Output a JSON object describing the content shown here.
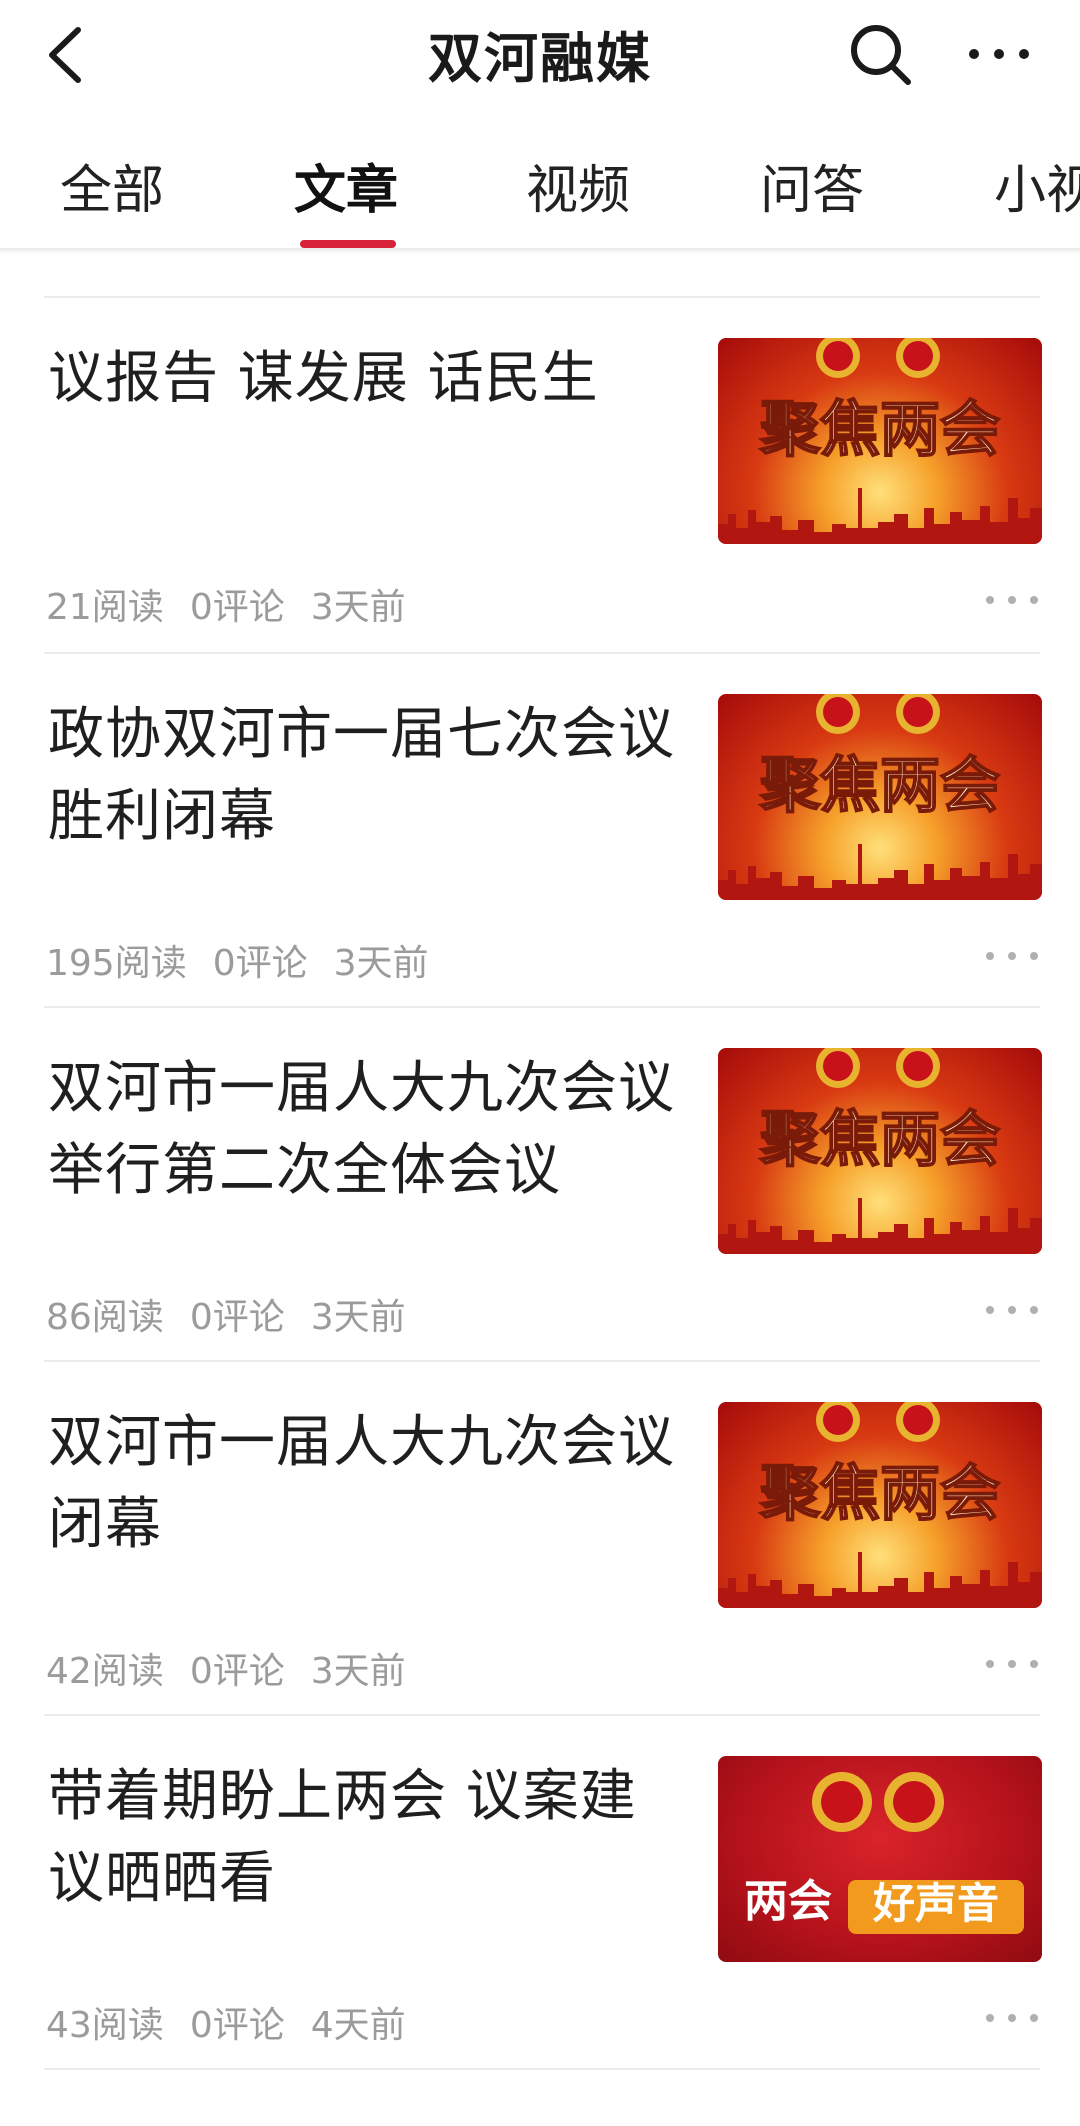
{
  "header": {
    "title": "双河融媒"
  },
  "tabs": [
    {
      "label": "全部"
    },
    {
      "label": "文章"
    },
    {
      "label": "视频"
    },
    {
      "label": "问答"
    },
    {
      "label": "小视"
    }
  ],
  "active_tab": "文章",
  "accent_color": "#d6223a",
  "articles": [
    {
      "title": "议报告 谋发展 话民生",
      "reads": "21阅读",
      "comments": "0评论",
      "time": "3天前",
      "thumb": {
        "text": "聚焦两会",
        "icon": "emblem-icon"
      }
    },
    {
      "title": "政协双河市一届七次会议胜利闭幕",
      "reads": "195阅读",
      "comments": "0评论",
      "time": "3天前",
      "thumb": {
        "text": "聚焦两会",
        "icon": "emblem-icon"
      }
    },
    {
      "title": "双河市一届人大九次会议举行第二次全体会议",
      "reads": "86阅读",
      "comments": "0评论",
      "time": "3天前",
      "thumb": {
        "text": "聚焦两会",
        "icon": "emblem-icon"
      }
    },
    {
      "title": "双河市一届人大九次会议闭幕",
      "reads": "42阅读",
      "comments": "0评论",
      "time": "3天前",
      "thumb": {
        "text": "聚焦两会",
        "icon": "emblem-icon"
      }
    },
    {
      "title": "带着期盼上两会 议案建议晒晒看",
      "reads": "43阅读",
      "comments": "0评论",
      "time": "4天前",
      "thumb": {
        "text": "两会",
        "text2": "好声音",
        "icon": "emblem-icon"
      }
    }
  ]
}
